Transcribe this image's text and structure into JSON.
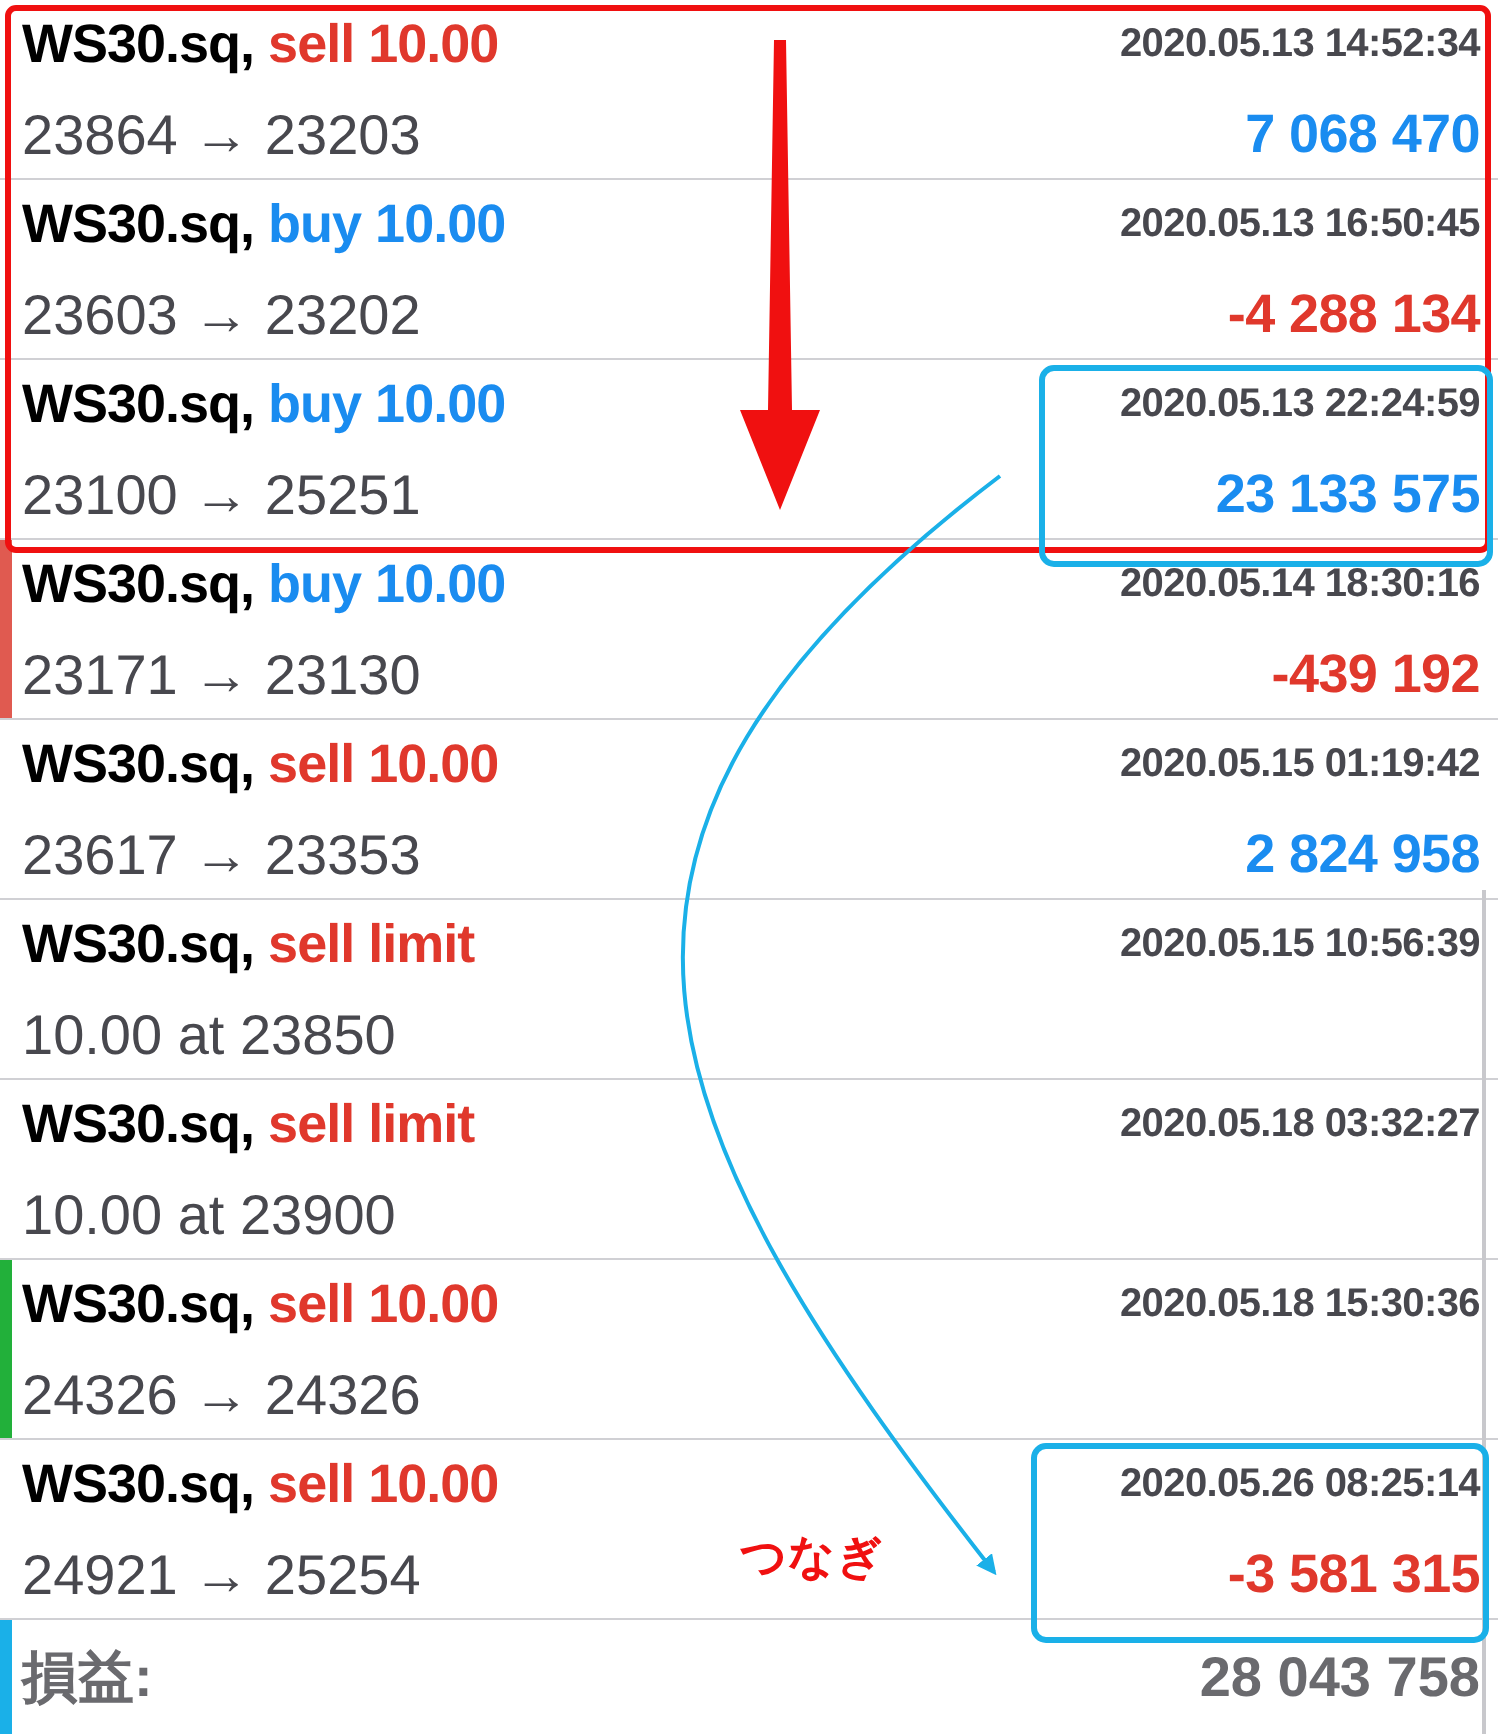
{
  "rows": [
    {
      "symbol": "WS30.sq,",
      "type": "sell 10.00",
      "color": "#e0382c",
      "time": "2020.05.13 14:52:34",
      "detail": "23864 → 23203",
      "profit": {
        "text": "7 068 470",
        "color": "#1a8cf0"
      }
    },
    {
      "symbol": "WS30.sq,",
      "type": "buy 10.00",
      "color": "#1a8cf0",
      "time": "2020.05.13 16:50:45",
      "detail": "23603 → 23202",
      "profit": {
        "text": "-4 288 134",
        "color": "#e0382c"
      }
    },
    {
      "symbol": "WS30.sq,",
      "type": "buy 10.00",
      "color": "#1a8cf0",
      "time": "2020.05.13 22:24:59",
      "detail": "23100 → 25251",
      "profit": {
        "text": "23 133 575",
        "color": "#1a8cf0"
      }
    },
    {
      "symbol": "WS30.sq,",
      "type": "buy 10.00",
      "color": "#1a8cf0",
      "time": "2020.05.14 18:30:16",
      "detail": "23171 → 23130",
      "profit": {
        "text": "-439 192",
        "color": "#e0382c"
      },
      "marker": {
        "color": "#e05a50"
      }
    },
    {
      "symbol": "WS30.sq,",
      "type": "sell 10.00",
      "color": "#e0382c",
      "time": "2020.05.15 01:19:42",
      "detail": "23617 → 23353",
      "profit": {
        "text": "2 824 958",
        "color": "#1a8cf0"
      }
    },
    {
      "symbol": "WS30.sq,",
      "type": "sell limit",
      "color": "#e0382c",
      "time": "2020.05.15 10:56:39",
      "detail": "10.00 at 23850"
    },
    {
      "symbol": "WS30.sq,",
      "type": "sell limit",
      "color": "#e0382c",
      "time": "2020.05.18 03:32:27",
      "detail": "10.00 at 23900"
    },
    {
      "symbol": "WS30.sq,",
      "type": "sell 10.00",
      "color": "#e0382c",
      "time": "2020.05.18 15:30:36",
      "detail": "24326 → 24326",
      "marker": {
        "color": "#22b03a"
      }
    },
    {
      "symbol": "WS30.sq,",
      "type": "sell 10.00",
      "color": "#e0382c",
      "time": "2020.05.26 08:25:14",
      "detail": "24921 → 25254",
      "profit": {
        "text": "-3 581 315",
        "color": "#e0382c"
      }
    }
  ],
  "footer": {
    "label": "損益:",
    "value": "28 043 758",
    "marker": {
      "color": "#1ab0e8"
    }
  },
  "annotation": {
    "label": "つなぎ"
  }
}
